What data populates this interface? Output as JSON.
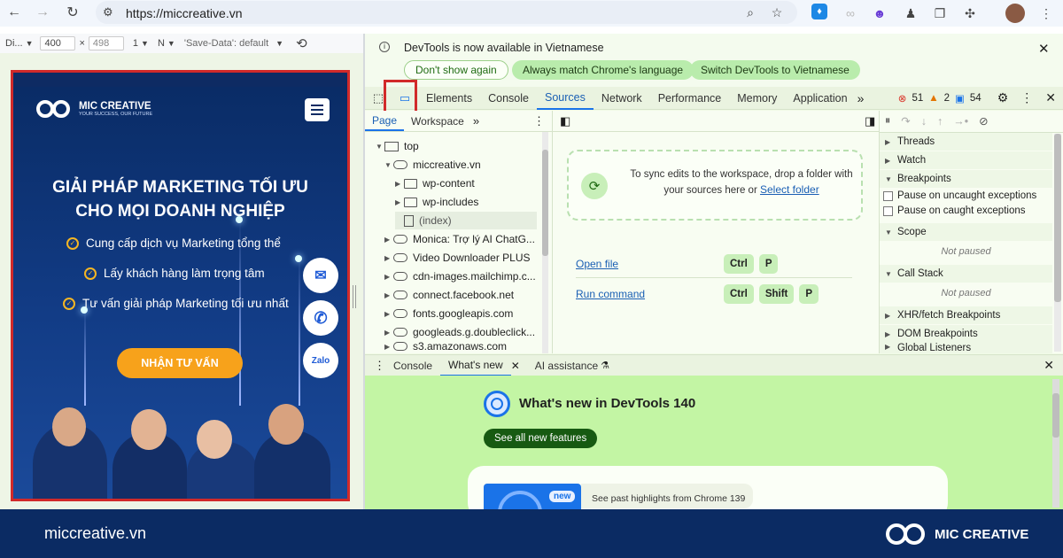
{
  "browser": {
    "url": "https://miccreative.vn",
    "nav": [
      "back-icon",
      "forward-icon",
      "reload-icon",
      "site-info-icon"
    ],
    "toolbar_icons": [
      "zoom-icon",
      "star-icon",
      "extension-drop-icon",
      "extension-link-icon",
      "extension-face-icon",
      "extension-person-icon",
      "extension-copy-icon",
      "puzzle-icon",
      "profile-avatar",
      "menu-dots-icon"
    ]
  },
  "device_toolbar": {
    "device": "Di...",
    "width": "400",
    "times": "×",
    "height": "498",
    "dpr": "1",
    "mode": "N",
    "throttle": "'Save-Data': default"
  },
  "site": {
    "brand": "MIC CREATIVE",
    "tagline": "YOUR SUCCESS, OUR FUTURE",
    "hero_line1": "GIẢI PHÁP MARKETING TỐI ƯU",
    "hero_line2": "CHO MỌI DOANH NGHIỆP",
    "benefits": [
      "Cung cấp dịch vụ Marketing tổng thể",
      "Lấy khách hàng làm trọng tâm",
      "Tư vấn giải pháp Marketing tối ưu nhất"
    ],
    "cta": "NHẬN TƯ VẤN",
    "zalo": "Zalo"
  },
  "devtools": {
    "notice": "DevTools is now available in Vietnamese",
    "btn_dont_show": "Don't show again",
    "btn_match": "Always match Chrome's language",
    "btn_switch": "Switch DevTools to Vietnamese",
    "tabs": [
      "Elements",
      "Console",
      "Sources",
      "Network",
      "Performance",
      "Memory",
      "Application"
    ],
    "more": "»",
    "errors": "51",
    "warnings": "2",
    "issues": "54",
    "nav_tabs": [
      "Page",
      "Workspace"
    ],
    "tree": {
      "top": "top",
      "domain": "miccreative.vn",
      "wp_content": "wp-content",
      "wp_includes": "wp-includes",
      "index": "(index)",
      "others": [
        "Monica: Trợ lý AI ChatG...",
        "Video Downloader PLUS",
        "cdn-images.mailchimp.c...",
        "connect.facebook.net",
        "fonts.googleapis.com",
        "googleads.g.doubleclick...",
        "s3.amazonaws.com"
      ]
    },
    "sync_text_1": "To sync edits to the workspace, drop a folder with",
    "sync_text_2": "your sources here or",
    "select_folder": "Select folder",
    "open_file": "Open file",
    "run_command": "Run command",
    "keys_open": [
      "Ctrl",
      "P"
    ],
    "keys_run": [
      "Ctrl",
      "Shift",
      "P"
    ],
    "sidebar": {
      "threads": "Threads",
      "watch": "Watch",
      "breakpoints": "Breakpoints",
      "pause_uncaught": "Pause on uncaught exceptions",
      "pause_caught": "Pause on caught exceptions",
      "scope": "Scope",
      "not_paused_1": "Not paused",
      "call_stack": "Call Stack",
      "not_paused_2": "Not paused",
      "xhr": "XHR/fetch Breakpoints",
      "dom": "DOM Breakpoints",
      "listeners": "Global Listeners"
    },
    "drawer_tabs": [
      "Console",
      "What's new",
      "AI assistance"
    ],
    "whats_new_title": "What's new in DevTools 140",
    "see_all": "See all new features",
    "new_badge": "new",
    "past_highlights": "See past highlights from Chrome 139"
  },
  "footer": {
    "url": "miccreative.vn",
    "brand": "MIC CREATIVE"
  },
  "colors": {
    "red_frame": "#d12a2a",
    "navy": "#0b2b63",
    "cta_orange": "#f7a21b",
    "devtools_green": "#c3f5a4"
  }
}
